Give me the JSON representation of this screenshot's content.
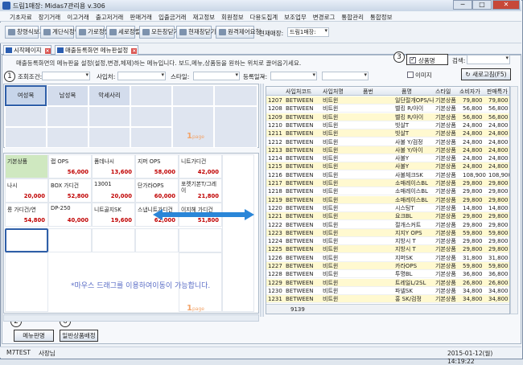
{
  "window": {
    "title": "드림1매장: Midas7관리용 v.306",
    "minimize": "─",
    "maximize": "□",
    "close": "✕"
  },
  "menu": [
    "기초자료",
    "장기거래",
    "이고거래",
    "출고저거래",
    "판매거래",
    "입출금거래",
    "재고정보",
    "회원정보",
    "다용도집계",
    "보조업무",
    "변경로그",
    "통합관리",
    "통합정보"
  ],
  "toolbar": {
    "buttons": [
      "창령식보기",
      "계단식정렬",
      "가로정렬",
      "세로정렬",
      "모든창닫기",
      "현재창닫기",
      "원격제어요청"
    ],
    "store_label": "현재매장:",
    "store_value": "드림1매장:"
  },
  "tabs": [
    {
      "label": "시작페이지"
    },
    {
      "label": "매출등록화면 메뉴판설정"
    }
  ],
  "description": "매출등록화면의 메뉴판을 설정(설정,변경,체제)하는 메뉴입니다. 보드,메뉴,상품등을 원하는 위치로 끌어옵기세요.",
  "callouts": {
    "c1": "1",
    "c2": "2",
    "c3": "3",
    "c4": "4",
    "c5": "5",
    "c6": "6"
  },
  "filters": {
    "query_label": "조회조건:",
    "vendor_label": "사입처:",
    "style_label": "스타일:",
    "date_label": "등록일자:"
  },
  "right_options": {
    "product_checkbox": "상품명",
    "product_checked": true,
    "search_label": "검색:",
    "image_checkbox": "이미지",
    "image_checked": false,
    "refresh_button": "새로고침(F5)"
  },
  "menu_grid": {
    "items": [
      "여성복",
      "남성복",
      "악세사리"
    ],
    "page": "1",
    "page_suffix": "page"
  },
  "product_grid": {
    "items": [
      {
        "name": "기본상품",
        "price": ""
      },
      {
        "name": "랩 OPS",
        "price": "56,000"
      },
      {
        "name": "폼데나시",
        "price": "13,600"
      },
      {
        "name": "지퍼 OPS",
        "price": "58,000"
      },
      {
        "name": "니트가디건",
        "price": "42,000"
      },
      {
        "name": "나시",
        "price": "20,000"
      },
      {
        "name": "BOX 가디건",
        "price": "52,800"
      },
      {
        "name": "13001",
        "price": "20,000"
      },
      {
        "name": "단가라OPS",
        "price": "60,000"
      },
      {
        "name": "포켓기본T/그레이",
        "price": "21,800"
      },
      {
        "name": "롱 가디건/연",
        "price": "54,800"
      },
      {
        "name": "DP-250",
        "price": "40,000"
      },
      {
        "name": "니트골지SK",
        "price": "19,600"
      },
      {
        "name": "스냅니트가디건",
        "price": "62,000"
      },
      {
        "name": "이지헤 가디건",
        "price": "51,800"
      }
    ],
    "note": "*마우스 드래그를 이용하여이동이 가능합니다.",
    "page": "1",
    "page_suffix": "page"
  },
  "bottom_buttons": {
    "menu_edit": "메뉴판명",
    "general_product": "일반상품배정"
  },
  "table": {
    "columns": [
      "사입처코드",
      "사입처명",
      "품번",
      "품명",
      "스타일",
      "소비자가",
      "판매특가"
    ],
    "rows": [
      [
        "1207",
        "BETWEEN",
        "비트윈",
        "",
        "일단절개OPS/나원",
        "기본상품",
        "79,800",
        "79,800"
      ],
      [
        "1208",
        "BETWEEN",
        "비트윈",
        "",
        "벨킹 R/아이",
        "기본상품",
        "56,800",
        "56,800"
      ],
      [
        "1209",
        "BETWEEN",
        "비트윈",
        "",
        "벨킹 R/아이",
        "기본상품",
        "56,800",
        "56,800"
      ],
      [
        "1210",
        "BETWEEN",
        "비트윈",
        "",
        "빗살T",
        "기본상품",
        "24,800",
        "24,800"
      ],
      [
        "1211",
        "BETWEEN",
        "비트윈",
        "",
        "빗살T",
        "기본상품",
        "24,800",
        "24,800"
      ],
      [
        "1212",
        "BETWEEN",
        "비트윈",
        "",
        "사불 Y/검정",
        "기본상품",
        "24,800",
        "24,800"
      ],
      [
        "1213",
        "BETWEEN",
        "비트윈",
        "",
        "사불 Y/아이",
        "기본상품",
        "24,800",
        "24,800"
      ],
      [
        "1214",
        "BETWEEN",
        "비트윈",
        "",
        "사불Y",
        "기본상품",
        "24,800",
        "24,800"
      ],
      [
        "1215",
        "BETWEEN",
        "비트윈",
        "",
        "사불Y",
        "기본상품",
        "24,800",
        "24,800"
      ],
      [
        "1216",
        "BETWEEN",
        "비트윈",
        "",
        "사불체크SK",
        "기본상품",
        "108,900",
        "108,900"
      ],
      [
        "1217",
        "BETWEEN",
        "비트윈",
        "",
        "소매레이스BL",
        "기본상품",
        "29,800",
        "29,800"
      ],
      [
        "1218",
        "BETWEEN",
        "비트윈",
        "",
        "소매레이스BL",
        "기본상품",
        "29,800",
        "29,800"
      ],
      [
        "1219",
        "BETWEEN",
        "비트윈",
        "",
        "소매레이스BL",
        "기본상품",
        "29,800",
        "29,800"
      ],
      [
        "1220",
        "BETWEEN",
        "비트윈",
        "",
        "시스팅T",
        "기본상품",
        "14,800",
        "14,800"
      ],
      [
        "1221",
        "BETWEEN",
        "비트윈",
        "",
        "요크BL",
        "기본상품",
        "29,800",
        "29,800"
      ],
      [
        "1222",
        "BETWEEN",
        "비트윈",
        "",
        "절개스커트",
        "기본상품",
        "29,800",
        "29,800"
      ],
      [
        "1223",
        "BETWEEN",
        "비트윈",
        "",
        "지지Y OPS",
        "기본상품",
        "59,800",
        "59,800"
      ],
      [
        "1224",
        "BETWEEN",
        "비트윈",
        "",
        "지방시 T",
        "기본상품",
        "29,800",
        "29,800"
      ],
      [
        "1225",
        "BETWEEN",
        "비트윈",
        "",
        "지방시 T",
        "기본상품",
        "29,800",
        "29,800"
      ],
      [
        "1226",
        "BETWEEN",
        "비트윈",
        "",
        "지머SK",
        "기본상품",
        "31,800",
        "31,800"
      ],
      [
        "1227",
        "BETWEEN",
        "비트윈",
        "",
        "카라OPS",
        "기본상품",
        "59,800",
        "59,800"
      ],
      [
        "1228",
        "BETWEEN",
        "비트윈",
        "",
        "투명BL",
        "기본상품",
        "36,800",
        "36,800"
      ],
      [
        "1229",
        "BETWEEN",
        "비트윈",
        "",
        "트레일L/2SL",
        "기본상품",
        "26,800",
        "26,800"
      ],
      [
        "1230",
        "BETWEEN",
        "비트윈",
        "",
        "파넬SK",
        "기본상품",
        "34,800",
        "34,800"
      ],
      [
        "1231",
        "BETWEEN",
        "비트윈",
        "",
        "홍 SK/검정",
        "기본상품",
        "34,800",
        "34,800"
      ]
    ],
    "footer_count": "9139"
  },
  "status": {
    "user": "M7TEST",
    "role": "사장님",
    "datetime": "2015-01-12(월) 14:19:22"
  },
  "colors": {
    "accent": "#2f5fa8",
    "price_red": "#c00000",
    "page_orange": "#f2a46a",
    "highlight_yellow": "#fff9d0",
    "note_blue": "#5a6dc6"
  }
}
